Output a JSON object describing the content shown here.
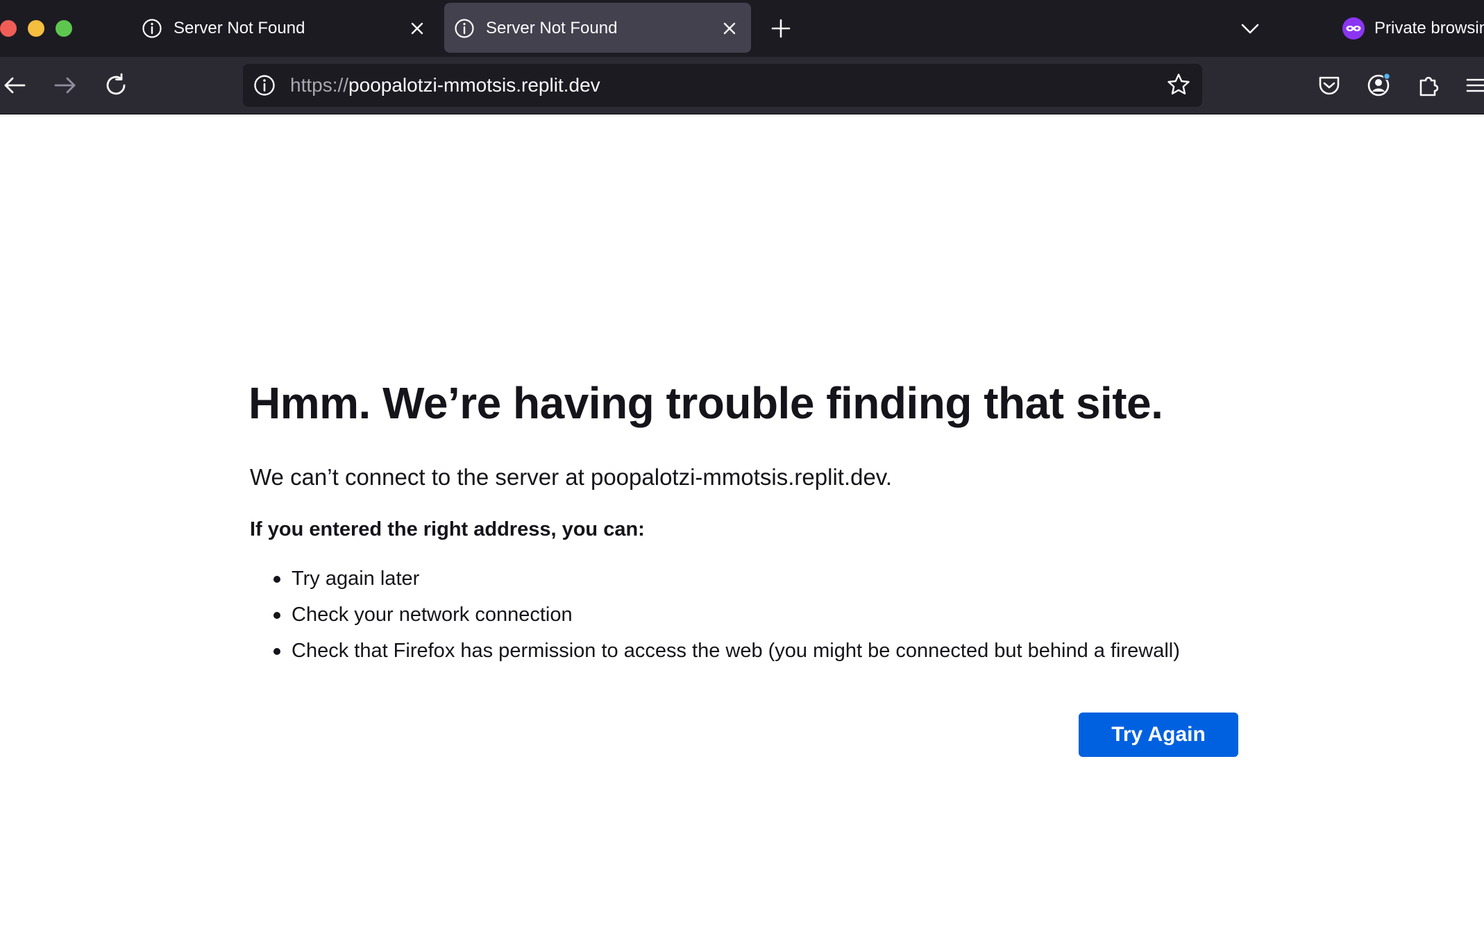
{
  "tabs": [
    {
      "title": "Server Not Found",
      "icon": "info-icon",
      "active": false
    },
    {
      "title": "Server Not Found",
      "icon": "info-icon",
      "active": true
    }
  ],
  "private_browsing": {
    "label": "Private browsin",
    "icon": "private-mask-icon"
  },
  "urlbar": {
    "scheme": "https://",
    "host": "poopalotzi-mmotsis.replit.dev"
  },
  "error": {
    "title": "Hmm. We’re having trouble finding that site.",
    "description": "We can’t connect to the server at poopalotzi-mmotsis.replit.dev.",
    "subheading": "If you entered the right address, you can:",
    "suggestions": [
      "Try again later",
      "Check your network connection",
      "Check that Firefox has permission to access the web (you might be connected but behind a firewall)"
    ],
    "button_label": "Try Again"
  },
  "colors": {
    "tabstrip_bg": "#1c1b22",
    "navbar_bg": "#2b2a33",
    "active_tab_bg": "#42414d",
    "button_blue": "#0061e0",
    "private_purple": "#8b35f2"
  }
}
